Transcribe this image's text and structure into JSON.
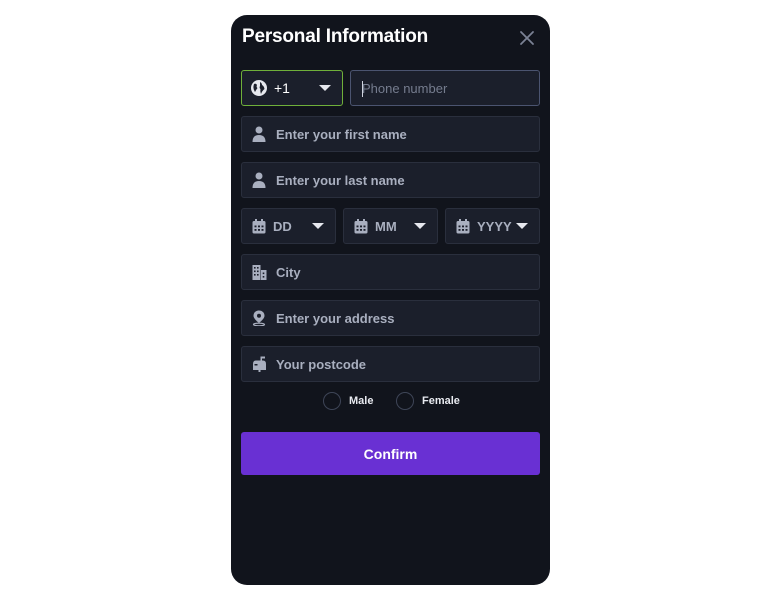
{
  "modal": {
    "title": "Personal Information",
    "close_icon": "close-icon"
  },
  "form": {
    "country_code": {
      "value": "+1",
      "icon": "globe-icon"
    },
    "phone": {
      "placeholder": "Phone number"
    },
    "first_name": {
      "placeholder": "Enter your first name",
      "icon": "user-icon"
    },
    "last_name": {
      "placeholder": "Enter your last name",
      "icon": "user-icon"
    },
    "dob": {
      "day": {
        "value": "DD",
        "icon": "calendar-icon"
      },
      "month": {
        "value": "MM",
        "icon": "calendar-icon"
      },
      "year": {
        "value": "YYYY",
        "icon": "calendar-icon"
      }
    },
    "city": {
      "placeholder": "City",
      "icon": "building-icon"
    },
    "address": {
      "placeholder": "Enter your address",
      "icon": "map-pin-icon"
    },
    "postcode": {
      "placeholder": "Your postcode",
      "icon": "mailbox-icon"
    },
    "gender": {
      "options": [
        {
          "label": "Male",
          "selected": false
        },
        {
          "label": "Female",
          "selected": false
        }
      ]
    },
    "confirm_label": "Confirm"
  },
  "colors": {
    "background": "#11141c",
    "field": "#1b1f2b",
    "accent": "#6930d3",
    "country_border": "#6fb03a",
    "text_muted": "#a9afbf"
  }
}
